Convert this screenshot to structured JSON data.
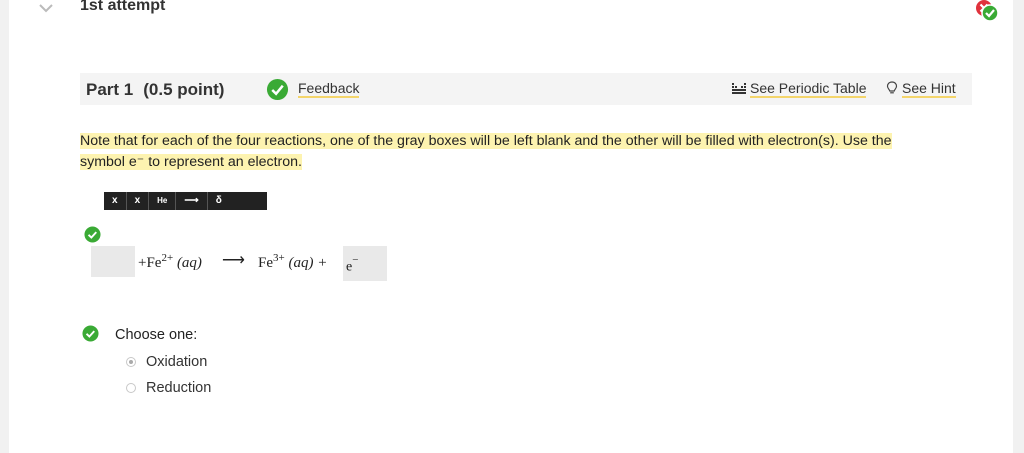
{
  "attempt": {
    "title": "1st attempt"
  },
  "part": {
    "label": "Part 1",
    "points": "(0.5 point)",
    "feedback": "Feedback",
    "periodic": "See Periodic Table",
    "hint": "See Hint"
  },
  "instructions": {
    "text": "Note that for each of the four reactions, one of the gray boxes will be left blank and the other will be filled with electron(s). Use the symbol e⁻ to represent an electron."
  },
  "toolbar": {
    "items": [
      "x",
      "x",
      "He",
      "⟶",
      "δ"
    ]
  },
  "equation": {
    "left_part": "+Fe",
    "left_charge": "2+",
    "left_state": "(aq)",
    "arrow": "⟶",
    "right_part": "Fe",
    "right_charge": "3+",
    "right_state": "(aq) +",
    "electron": "e",
    "electron_charge": "−"
  },
  "choice": {
    "label": "Choose one:",
    "options": [
      "Oxidation",
      "Reduction"
    ],
    "selected": "Oxidation"
  },
  "colors": {
    "success": "#3aaa35",
    "error": "#e0323c",
    "highlight": "#fdf3b0",
    "link_underline": "#f4d56b"
  }
}
